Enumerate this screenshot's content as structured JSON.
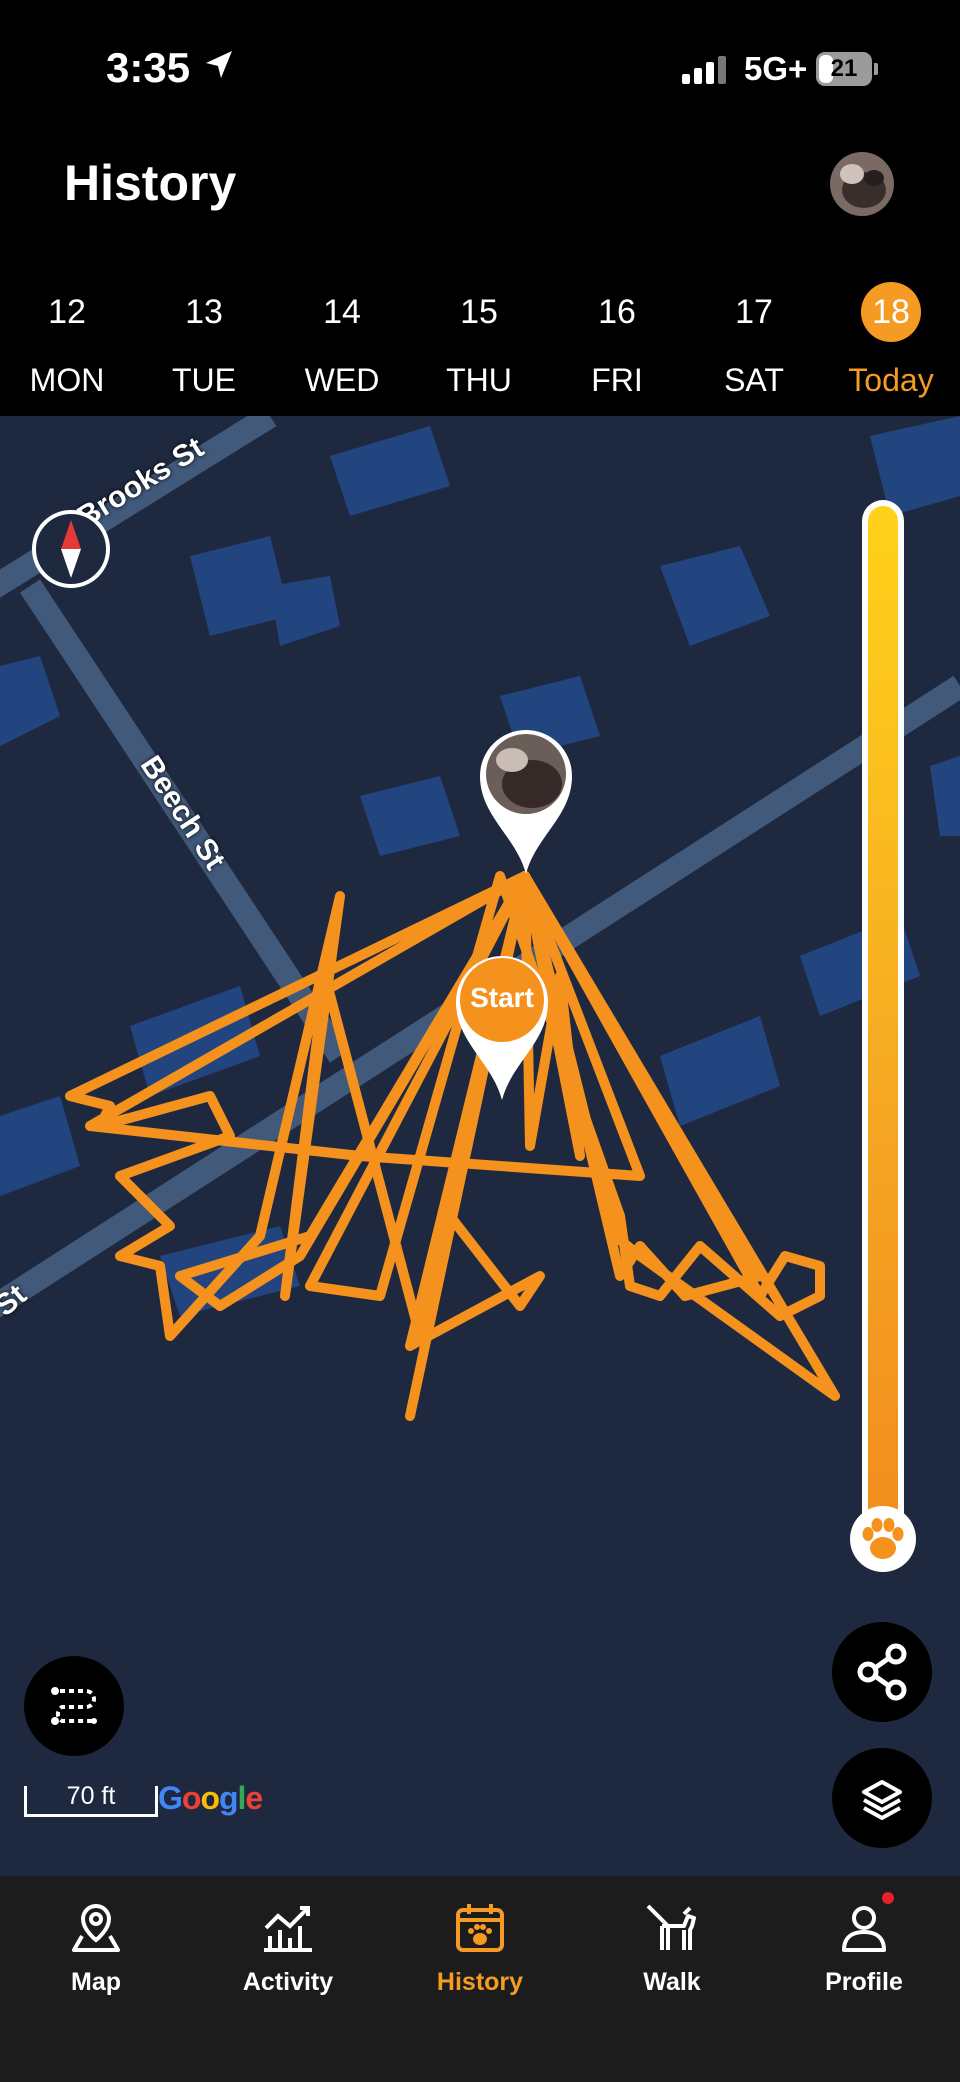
{
  "status_bar": {
    "time": "3:35",
    "network": "5G+",
    "battery": "21"
  },
  "header": {
    "title": "History"
  },
  "days": [
    {
      "num": "12",
      "label": "MON"
    },
    {
      "num": "13",
      "label": "TUE"
    },
    {
      "num": "14",
      "label": "WED"
    },
    {
      "num": "15",
      "label": "THU"
    },
    {
      "num": "16",
      "label": "FRI"
    },
    {
      "num": "17",
      "label": "SAT"
    },
    {
      "num": "18",
      "label": "Today",
      "selected": true
    }
  ],
  "map": {
    "streets": [
      "Brooks St",
      "Beech St",
      "St"
    ],
    "start_label": "Start",
    "scale": "70 ft",
    "attribution": "Google"
  },
  "tabs": [
    {
      "label": "Map",
      "icon": "map-pin-icon"
    },
    {
      "label": "Activity",
      "icon": "activity-chart-icon"
    },
    {
      "label": "History",
      "icon": "calendar-paw-icon",
      "active": true
    },
    {
      "label": "Walk",
      "icon": "dog-walk-icon"
    },
    {
      "label": "Profile",
      "icon": "person-icon",
      "badge": true
    }
  ],
  "colors": {
    "accent": "#f59a23",
    "map_bg": "#1e2940",
    "building": "#23457f",
    "road": "#41597a"
  }
}
